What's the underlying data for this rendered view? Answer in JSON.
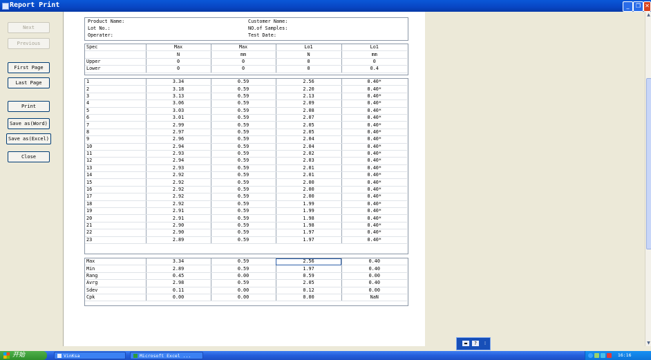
{
  "window": {
    "title": "Report Print"
  },
  "buttons": {
    "next": "Next",
    "previous": "Previous",
    "first_page": "First Page",
    "last_page": "Last Page",
    "print": "Print",
    "save_word": "Save as(Word)",
    "save_excel": "Save as(Excel)",
    "close": "Close"
  },
  "report": {
    "product_name_label": "Product Name:",
    "customer_name_label": "Customer Name:",
    "lot_no_label": "Lot No.:",
    "samples_label": "NO.of Samples:",
    "operater_label": "Operater:",
    "test_date_label": "Test Date:",
    "spec_header": [
      "Spec",
      "Max",
      "Max",
      "Lo1",
      "Lo1"
    ],
    "units": [
      "",
      "N",
      "mm",
      "N",
      "mm"
    ],
    "upper": [
      "Upper",
      "0",
      "0",
      "0",
      "0"
    ],
    "lower": [
      "Lower",
      "0",
      "0",
      "0",
      "0.4"
    ],
    "samples": [
      [
        "1",
        "3.34",
        "0.59",
        "2.56",
        "0.40*"
      ],
      [
        "2",
        "3.18",
        "0.59",
        "2.20",
        "0.40*"
      ],
      [
        "3",
        "3.13",
        "0.59",
        "2.13",
        "0.40*"
      ],
      [
        "4",
        "3.06",
        "0.59",
        "2.09",
        "0.40*"
      ],
      [
        "5",
        "3.03",
        "0.59",
        "2.08",
        "0.40*"
      ],
      [
        "6",
        "3.01",
        "0.59",
        "2.07",
        "0.40*"
      ],
      [
        "7",
        "2.99",
        "0.59",
        "2.05",
        "0.40*"
      ],
      [
        "8",
        "2.97",
        "0.59",
        "2.05",
        "0.40*"
      ],
      [
        "9",
        "2.96",
        "0.59",
        "2.04",
        "0.40*"
      ],
      [
        "10",
        "2.94",
        "0.59",
        "2.04",
        "0.40*"
      ],
      [
        "11",
        "2.93",
        "0.59",
        "2.02",
        "0.40*"
      ],
      [
        "12",
        "2.94",
        "0.59",
        "2.03",
        "0.40*"
      ],
      [
        "13",
        "2.93",
        "0.59",
        "2.01",
        "0.40*"
      ],
      [
        "14",
        "2.92",
        "0.59",
        "2.01",
        "0.40*"
      ],
      [
        "15",
        "2.92",
        "0.59",
        "2.00",
        "0.40*"
      ],
      [
        "16",
        "2.92",
        "0.59",
        "2.00",
        "0.40*"
      ],
      [
        "17",
        "2.92",
        "0.59",
        "2.00",
        "0.40*"
      ],
      [
        "18",
        "2.92",
        "0.59",
        "1.99",
        "0.40*"
      ],
      [
        "19",
        "2.91",
        "0.59",
        "1.99",
        "0.40*"
      ],
      [
        "20",
        "2.91",
        "0.59",
        "1.98",
        "0.40*"
      ],
      [
        "21",
        "2.90",
        "0.59",
        "1.98",
        "0.40*"
      ],
      [
        "22",
        "2.90",
        "0.59",
        "1.97",
        "0.40*"
      ],
      [
        "23",
        "2.89",
        "0.59",
        "1.97",
        "0.40*"
      ]
    ],
    "stats": [
      [
        "Max",
        "3.34",
        "0.59",
        "2.56",
        "0.40"
      ],
      [
        "Min",
        "2.89",
        "0.59",
        "1.97",
        "0.40"
      ],
      [
        "Rang",
        "0.45",
        "0.00",
        "0.59",
        "0.00"
      ],
      [
        "Avrg",
        "2.98",
        "0.59",
        "2.05",
        "0.40"
      ],
      [
        "Sdev",
        "0.11",
        "0.00",
        "0.12",
        "0.00"
      ],
      [
        "Cpk",
        "0.00",
        "0.00",
        "0.00",
        "NaN"
      ]
    ]
  },
  "taskbar": {
    "start_label": "开始",
    "tasks": [
      "VinKsa",
      "Microsoft Excel ..."
    ],
    "clock": "16:16"
  }
}
